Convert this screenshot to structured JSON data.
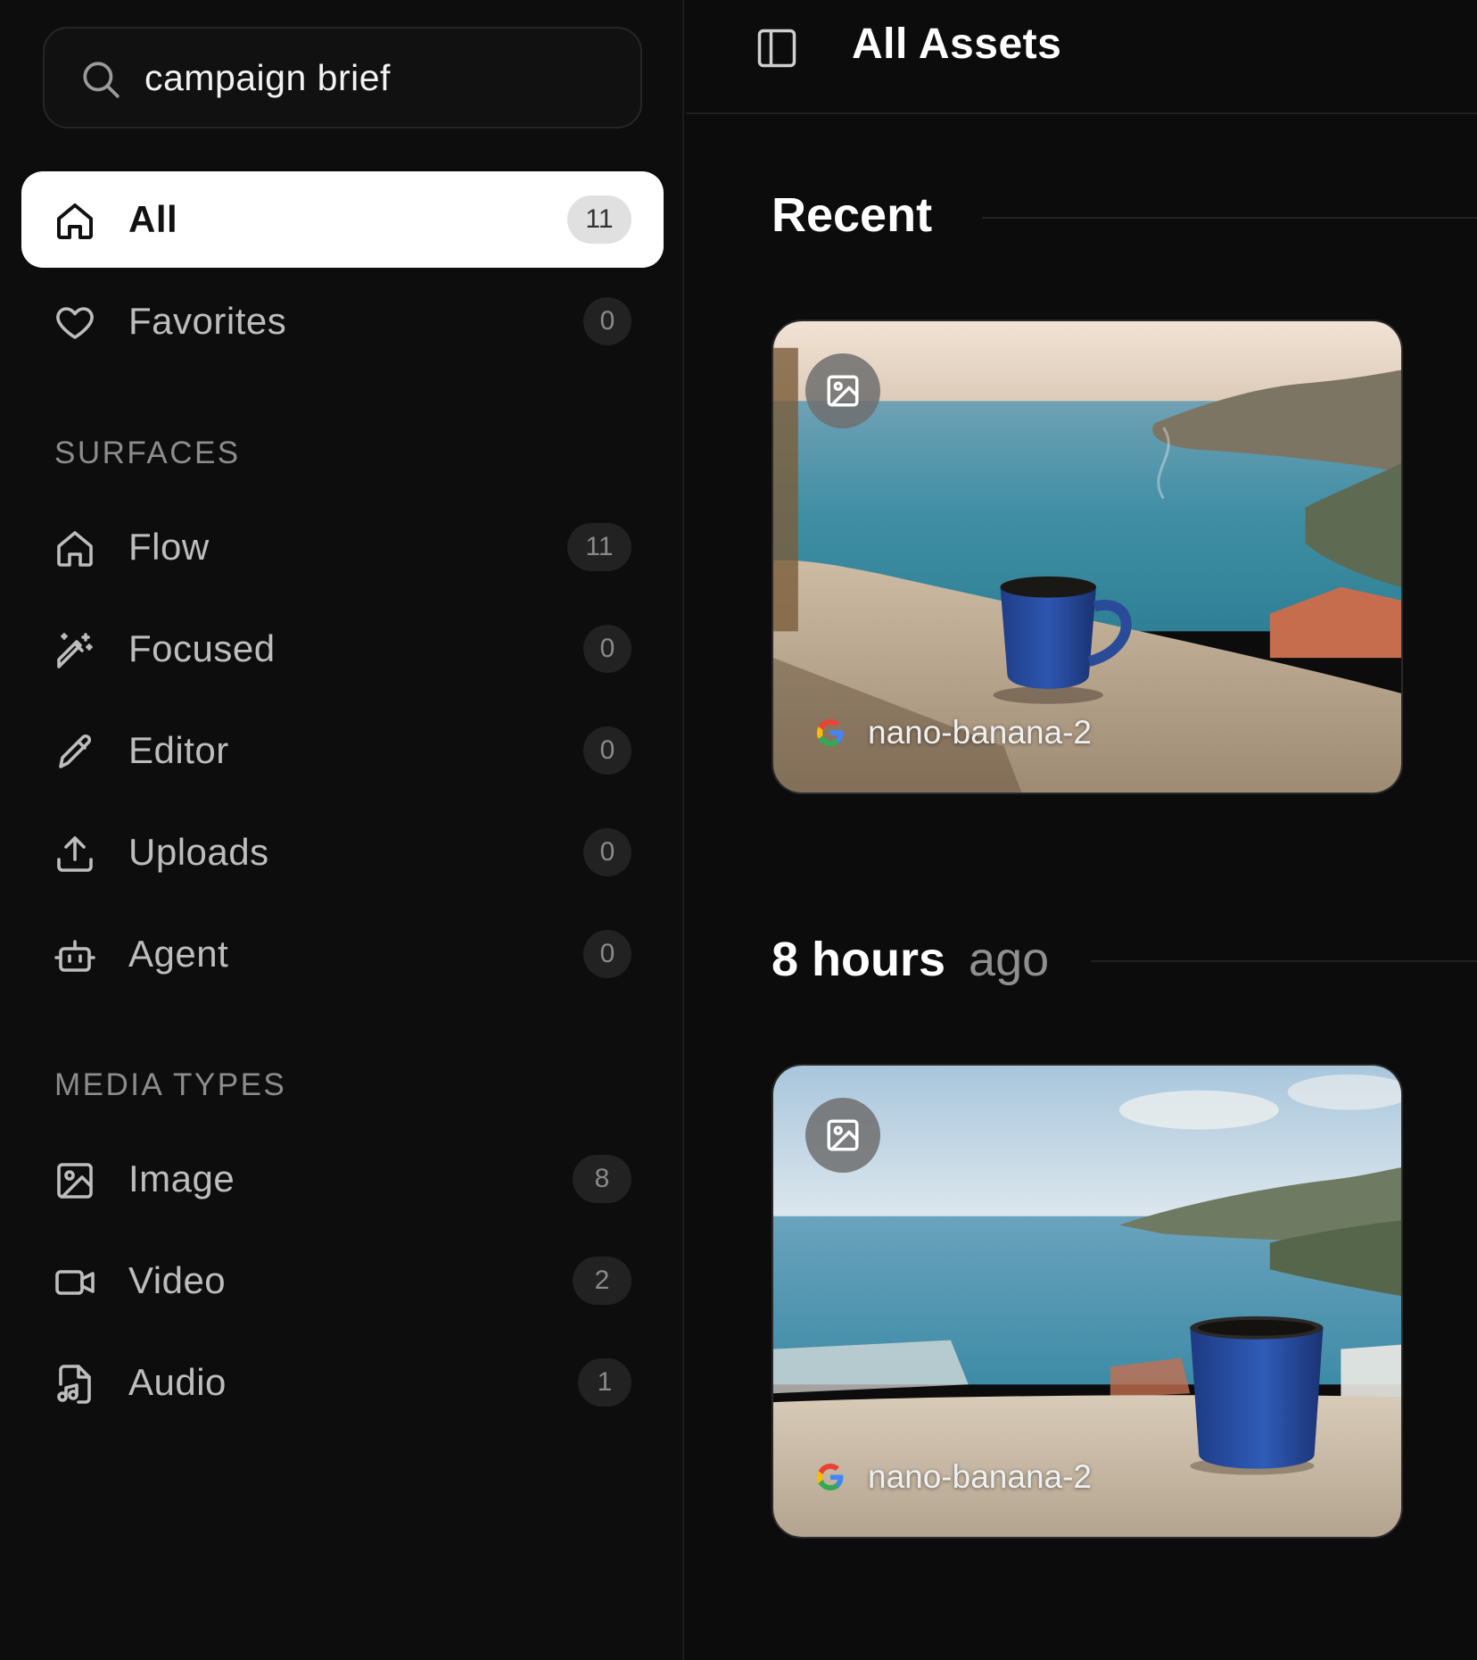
{
  "search": {
    "value": "campaign brief",
    "placeholder": ""
  },
  "nav": {
    "all": {
      "label": "All",
      "count": "11"
    },
    "favorites": {
      "label": "Favorites",
      "count": "0"
    }
  },
  "surfaces": {
    "title": "SURFACES",
    "items": [
      {
        "label": "Flow",
        "count": "11",
        "icon": "home-icon"
      },
      {
        "label": "Focused",
        "count": "0",
        "icon": "magic-wand-icon"
      },
      {
        "label": "Editor",
        "count": "0",
        "icon": "pencil-icon"
      },
      {
        "label": "Uploads",
        "count": "0",
        "icon": "upload-icon"
      },
      {
        "label": "Agent",
        "count": "0",
        "icon": "robot-icon"
      }
    ]
  },
  "media_types": {
    "title": "MEDIA TYPES",
    "items": [
      {
        "label": "Image",
        "count": "8",
        "icon": "image-icon"
      },
      {
        "label": "Video",
        "count": "2",
        "icon": "video-icon"
      },
      {
        "label": "Audio",
        "count": "1",
        "icon": "audio-file-icon"
      }
    ]
  },
  "header": {
    "title": "All Assets"
  },
  "groups": [
    {
      "heading": "Recent",
      "subheading": "",
      "asset": {
        "model": "nano-banana-2",
        "type_icon": "image-icon"
      }
    },
    {
      "heading": "8 hours",
      "subheading": "ago",
      "asset": {
        "model": "nano-banana-2",
        "type_icon": "image-icon"
      }
    }
  ],
  "colors": {
    "background": "#0c0c0c",
    "active_item": "#ffffff",
    "muted_text": "#8c8c8c"
  }
}
